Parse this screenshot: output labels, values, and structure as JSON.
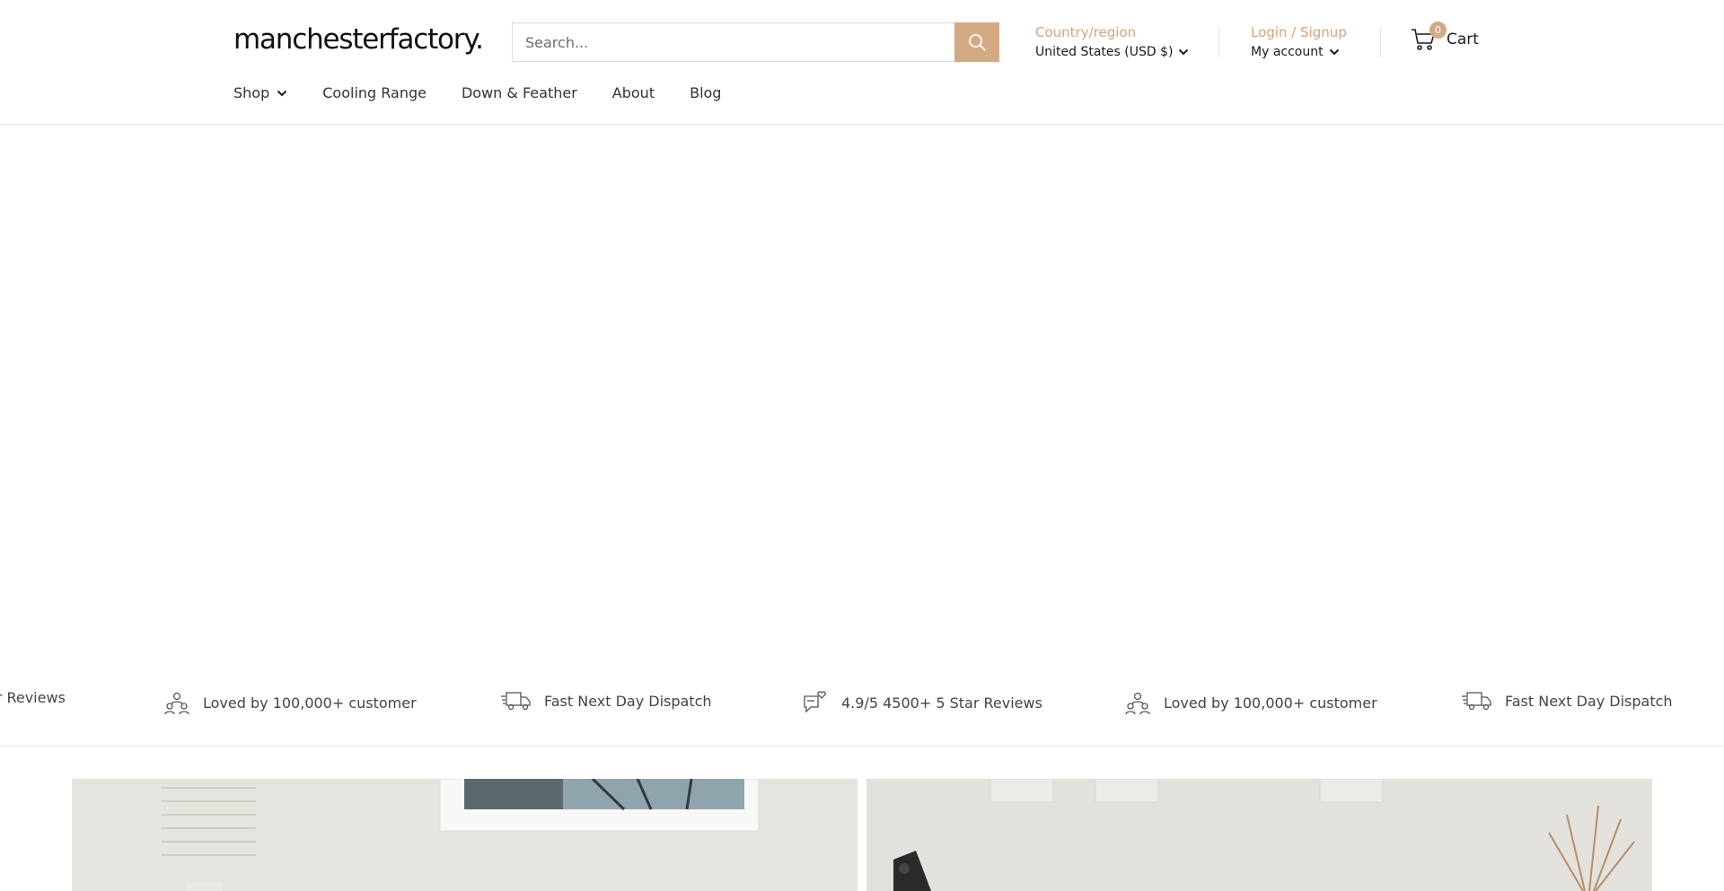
{
  "header": {
    "logo": "manchesterfactory.",
    "search_placeholder": "Search...",
    "region_label": "Country/region",
    "region_value": "United States (USD $)",
    "account_label": "Login / Signup",
    "account_value": "My account",
    "cart_label": "Cart",
    "cart_count": "0"
  },
  "nav": {
    "shop": "Shop",
    "cooling": "Cooling Range",
    "down": "Down & Feather",
    "about": "About",
    "blog": "Blog"
  },
  "features": {
    "f1": "ar Reviews",
    "f2": "Loved by 100,000+ customer",
    "f3": "Fast Next Day Dispatch",
    "f4": "4.9/5 4500+ 5 Star Reviews",
    "f5": "Loved by 100,000+ customer",
    "f6": "Fast Next Day Dispatch"
  },
  "colors": {
    "accent": "#d4aa83",
    "accent_text": "#d4a57a"
  }
}
